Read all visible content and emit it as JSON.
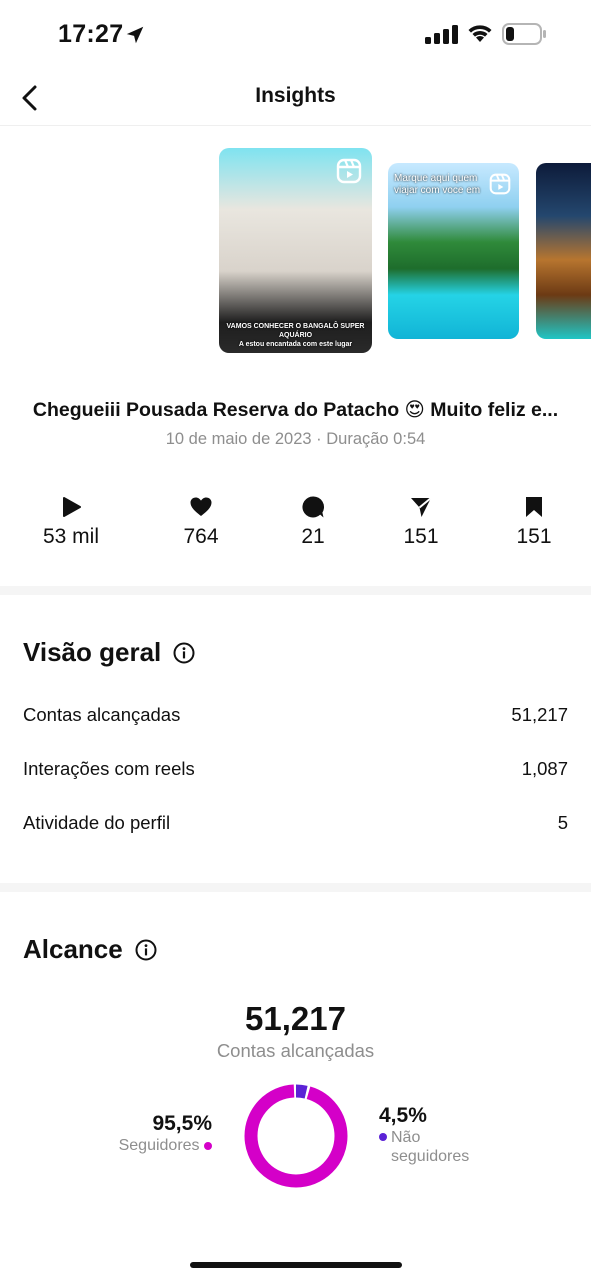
{
  "status_bar": {
    "time": "17:27"
  },
  "header": {
    "title": "Insights"
  },
  "thumbnails": {
    "first_caption_line1": "VAMOS CONHECER O BANGALÔ SUPER AQUÁRIO",
    "first_caption_line2": "A estou encantada com este lugar",
    "second_overlay": "Marque aqui quem viajar com voce em"
  },
  "post": {
    "title": "Chegueiii Pousada Reserva do Patacho 😍 Muito feliz e...",
    "meta": "10 de maio de 2023 · Duração 0:54"
  },
  "stats": {
    "plays": "53 mil",
    "likes": "764",
    "comments": "21",
    "shares": "151",
    "saves": "151"
  },
  "overview": {
    "title": "Visão geral",
    "rows": [
      {
        "label": "Contas alcançadas",
        "value": "51,217"
      },
      {
        "label": "Interações com reels",
        "value": "1,087"
      },
      {
        "label": "Atividade do perfil",
        "value": "5"
      }
    ]
  },
  "reach": {
    "title": "Alcance",
    "value": "51,217",
    "label": "Contas alcançadas",
    "followers_pct": "95,5%",
    "followers_label": "Seguidores",
    "non_followers_pct": "4,5%",
    "non_followers_label_line1": "Não",
    "non_followers_label_line2": "seguidores",
    "followers_fraction": 0.955,
    "non_followers_fraction": 0.045,
    "followers_color": "#d400c8",
    "non_followers_color": "#5b22d6"
  }
}
